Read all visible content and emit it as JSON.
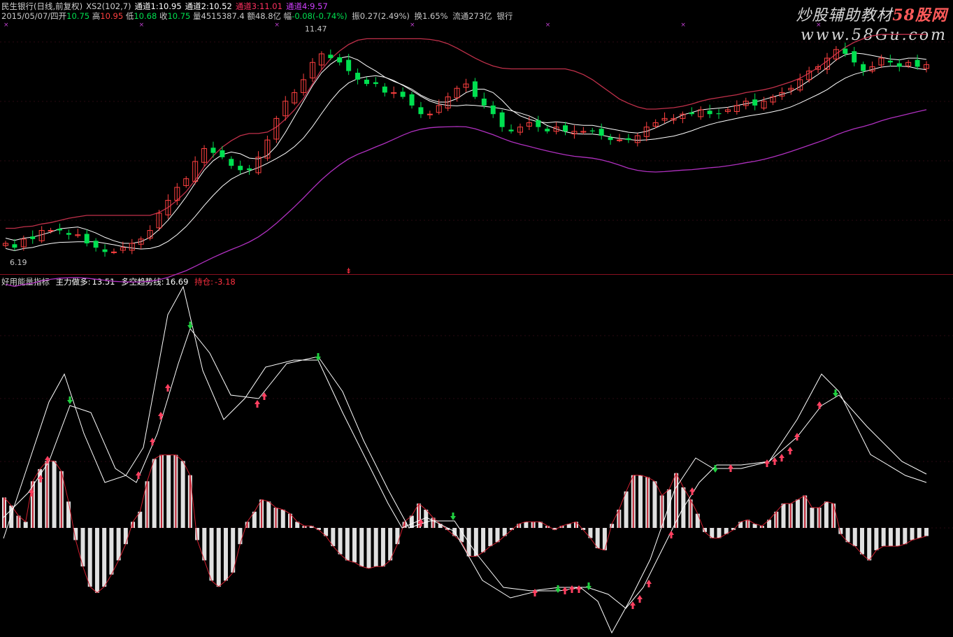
{
  "header": {
    "stock_name": "民生银行(日线,前复权)",
    "indicator": "XS2(102,7)",
    "ch1_label": "通道1:",
    "ch1_value": "10.95",
    "ch2_label": "通道2:",
    "ch2_value": "10.52",
    "ch3_label": "通道3:",
    "ch3_value": "11.01",
    "ch4_label": "通道4:",
    "ch4_value": "9.57"
  },
  "quote": {
    "date": "2015/05/07/四",
    "open_label": "开",
    "open": "10.75",
    "high_label": "高",
    "high": "10.95",
    "low_label": "低",
    "low": "10.68",
    "close_label": "收",
    "close": "10.75",
    "volume_label": "量",
    "volume": "4515387.4",
    "amount_label": "额",
    "amount": "48.8亿",
    "change_label": "幅",
    "change": "-0.08(-0.74%)",
    "amplitude_label": "振",
    "amplitude": "0.27(2.49%)",
    "turnover_label": "换",
    "turnover": "1.65%",
    "float_label": "流通",
    "float": "273亿",
    "sector": "银行"
  },
  "sub_indicator": {
    "name": "好用能量指标",
    "main_label": "主力做多:",
    "main_value": "13.51",
    "trend_label": "多空趋势线:",
    "trend_value": "16.69",
    "hold_label": "持仓:",
    "hold_value": "-3.18"
  },
  "price_marks": {
    "high_mark": "11.47",
    "low_mark": "6.19"
  },
  "watermark": {
    "line1_a": "炒股辅助教材",
    "line1_b": "58股网",
    "line2": "www.58Gu.com"
  },
  "colors": {
    "up": "#ff4040",
    "down": "#00e050",
    "channel_upper": "#c0304a",
    "channel_lower": "#b030c0",
    "line": "#ffffff",
    "divider": "#8a1020"
  },
  "chart_data": [
    {
      "type": "candlestick",
      "title": "民生银行(日线,前复权)",
      "note": "approximate daily closes read from the chart",
      "close": [
        6.6,
        6.5,
        6.7,
        6.7,
        6.9,
        6.9,
        6.9,
        6.8,
        6.8,
        6.6,
        6.5,
        6.4,
        6.4,
        6.5,
        6.6,
        6.7,
        6.9,
        7.3,
        7.6,
        7.9,
        8.1,
        8.5,
        8.8,
        8.7,
        8.6,
        8.4,
        8.3,
        8.3,
        8.6,
        9.0,
        9.5,
        9.9,
        10.1,
        10.4,
        10.8,
        11.0,
        10.9,
        10.8,
        10.6,
        10.4,
        10.3,
        10.3,
        10.1,
        10.1,
        10.0,
        9.8,
        9.6,
        9.6,
        9.8,
        10.0,
        10.2,
        10.3,
        10.0,
        9.8,
        9.6,
        9.3,
        9.2,
        9.3,
        9.4,
        9.3,
        9.2,
        9.3,
        9.2,
        9.2,
        9.2,
        9.2,
        9.1,
        9.0,
        9.0,
        9.0,
        9.1,
        9.3,
        9.4,
        9.5,
        9.5,
        9.6,
        9.6,
        9.7,
        9.6,
        9.6,
        9.7,
        9.8,
        9.9,
        9.8,
        9.9,
        10.0,
        10.1,
        10.2,
        10.4,
        10.6,
        10.7,
        10.9,
        11.1,
        11.0,
        10.8,
        10.6,
        10.7,
        10.9,
        10.8,
        10.7,
        10.8,
        10.7,
        10.75
      ],
      "channel_upper_last": 11.01,
      "channel_lower_last": 9.57,
      "high_label": 11.47,
      "low_label": 6.19
    },
    {
      "type": "bar",
      "title": "好用能量指标",
      "series": [
        {
          "name": "主力做多",
          "last": 13.51
        },
        {
          "name": "多空趋势线",
          "last": 16.69
        },
        {
          "name": "持仓",
          "values": [
            1.5,
            1.1,
            0.6,
            0.3,
            2.3,
            2.9,
            3.3,
            3.3,
            2.8,
            1.3,
            -0.6,
            -1.9,
            -2.9,
            -3.2,
            -2.9,
            -2.3,
            -1.6,
            -0.8,
            0.3,
            0.8,
            2.3,
            3.4,
            3.6,
            3.6,
            3.6,
            3.3,
            2.6,
            -0.6,
            -1.6,
            -2.6,
            -2.9,
            -2.6,
            -2.2,
            -0.8,
            0.3,
            0.8,
            1.4,
            1.3,
            1.0,
            0.9,
            0.7,
            0.3,
            0.1,
            0.1,
            -0.1,
            -0.4,
            -0.9,
            -1.3,
            -1.6,
            -1.7,
            -1.9,
            -2.0,
            -1.9,
            -1.9,
            -1.6,
            -0.8,
            0.3,
            0.6,
            1.2,
            0.9,
            0.5,
            0.2,
            -0.1,
            -0.4,
            -0.7,
            -1.4,
            -1.4,
            -1.2,
            -0.9,
            -0.7,
            -0.4,
            -0.1,
            0.2,
            0.3,
            0.3,
            0.3,
            0.1,
            -0.1,
            0.1,
            0.2,
            0.3,
            -0.1,
            -0.5,
            -1.0,
            -1.1,
            0.2,
            0.9,
            1.8,
            2.6,
            2.6,
            2.5,
            2.3,
            1.6,
            1.9,
            2.7,
            2.0,
            1.4,
            0.7,
            -0.2,
            -0.5,
            -0.5,
            -0.3,
            -0.1,
            0.3,
            0.4,
            0.2,
            0.1,
            0.4,
            0.8,
            1.2,
            1.2,
            1.4,
            1.6,
            1.0,
            1.0,
            1.3,
            1.2,
            -0.3,
            -0.7,
            -0.9,
            -1.3,
            -1.6,
            -1.1,
            -0.9,
            -0.9,
            -0.9,
            -0.8,
            -0.6,
            -0.5,
            -0.4
          ],
          "last": -3.18
        }
      ]
    }
  ]
}
